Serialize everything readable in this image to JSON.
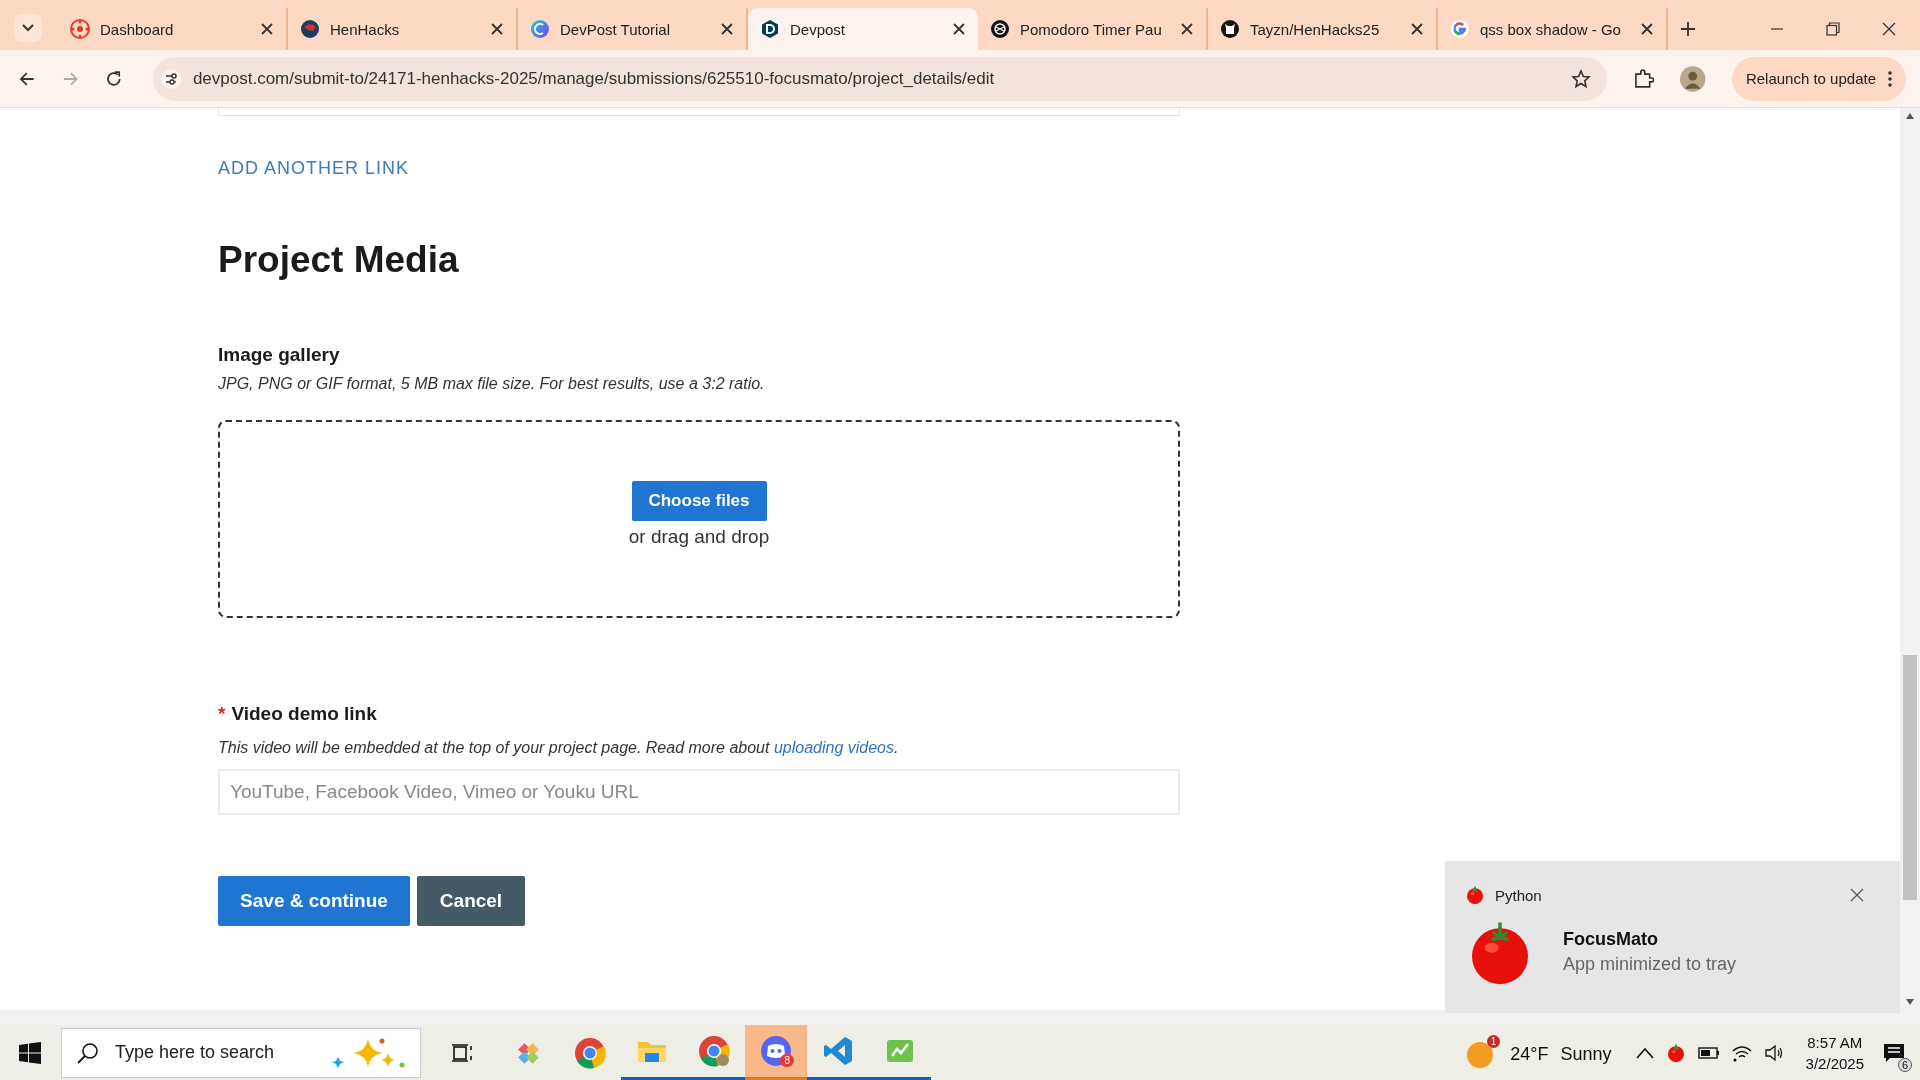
{
  "browser": {
    "tabs": [
      {
        "title": "Dashboard",
        "selected": false
      },
      {
        "title": "HenHacks",
        "selected": false
      },
      {
        "title": "DevPost Tutorial",
        "selected": false
      },
      {
        "title": "Devpost",
        "selected": true
      },
      {
        "title": "Pomodoro Timer Pau",
        "selected": false
      },
      {
        "title": "Tayzn/HenHacks25",
        "selected": false
      },
      {
        "title": "qss box shadow - Go",
        "selected": false
      }
    ],
    "address": "devpost.com/submit-to/24171-henhacks-2025/manage/submissions/625510-focusmato/project_details/edit",
    "relaunch_button": "Relaunch to update"
  },
  "page": {
    "add_link": "ADD ANOTHER LINK",
    "section_title": "Project Media",
    "gallery": {
      "label": "Image gallery",
      "hint": "JPG, PNG or GIF format, 5 MB max file size. For best results, use a 3:2 ratio.",
      "choose_button": "Choose files",
      "drop_text": "or drag and drop"
    },
    "video": {
      "required_mark": "*",
      "label": "Video demo link",
      "hint": "This video will be embedded at the top of your project page. Read more about ",
      "hint_link": "uploading videos",
      "hint_end": ".",
      "placeholder": "YouTube, Facebook Video, Vimeo or Youku URL"
    },
    "buttons": [
      {
        "label": "Save & continue",
        "kind": "primary"
      },
      {
        "label": "Cancel",
        "kind": "secondary"
      }
    ]
  },
  "notification": {
    "app": "Python",
    "title": "FocusMato",
    "message": "App minimized to tray"
  },
  "taskbar": {
    "search_placeholder": "Type here to search",
    "apps": [
      {
        "running": false,
        "selected": false
      },
      {
        "running": false,
        "selected": false
      },
      {
        "running": true,
        "selected": false
      },
      {
        "running": true,
        "selected": false
      },
      {
        "running": true,
        "selected": true,
        "badge": "8"
      },
      {
        "running": true,
        "selected": false
      },
      {
        "running": true,
        "selected": false
      }
    ],
    "weather": {
      "badge": "1",
      "temperature": "24°F",
      "condition": "Sunny"
    },
    "time": "8:57 AM",
    "date": "3/2/2025",
    "notification_count": "6"
  }
}
